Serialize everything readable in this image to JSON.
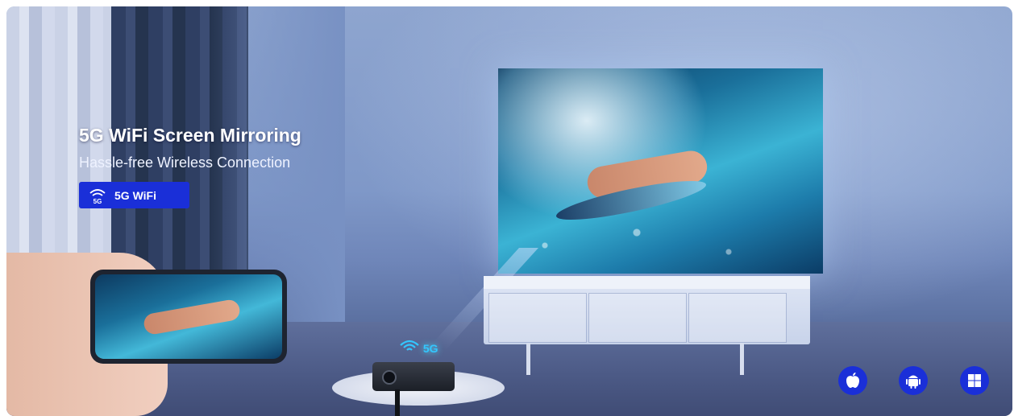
{
  "headline": {
    "title": "5G WiFi Screen Mirroring",
    "subtitle": "Hassle-free Wireless Connection"
  },
  "badge": {
    "label": "5G WiFi",
    "icon": "wifi-5g-icon",
    "icon_text": "5G",
    "color": "#1a2fd8"
  },
  "projector": {
    "wifi_label": "5G"
  },
  "platforms": [
    {
      "icon": "apple-icon"
    },
    {
      "icon": "android-icon"
    },
    {
      "icon": "windows-icon"
    }
  ],
  "colors": {
    "accent": "#1a2fd8",
    "wifi_glow": "#33c7ff"
  }
}
